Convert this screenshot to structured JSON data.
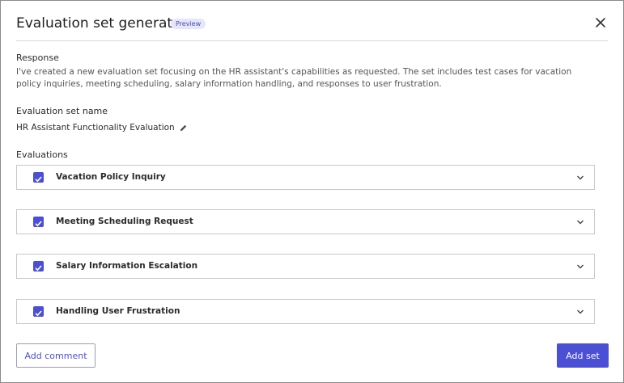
{
  "modal": {
    "title": "Evaluation set generator",
    "badge": "Preview"
  },
  "response": {
    "label": "Response",
    "text": "I've created a new evaluation set focusing on the HR assistant's capabilities as requested. The set includes test cases for vacation policy inquiries, meeting scheduling, salary information handling, and responses to user frustration."
  },
  "set_name": {
    "label": "Evaluation set name",
    "value": "HR Assistant Functionality Evaluation"
  },
  "evaluations": {
    "label": "Evaluations",
    "items": [
      {
        "label": "Vacation Policy Inquiry",
        "checked": true
      },
      {
        "label": "Meeting Scheduling Request",
        "checked": true
      },
      {
        "label": "Salary Information Escalation",
        "checked": true
      },
      {
        "label": "Handling User Frustration",
        "checked": true
      }
    ]
  },
  "footer": {
    "add_comment": "Add comment",
    "add_set": "Add set"
  },
  "colors": {
    "accent": "#4b4fd6",
    "badge_bg": "#e6e6fa"
  },
  "icons": {
    "close": "close-icon",
    "edit": "pencil-icon",
    "check": "checkmark-icon",
    "expand": "chevron-down-icon"
  }
}
